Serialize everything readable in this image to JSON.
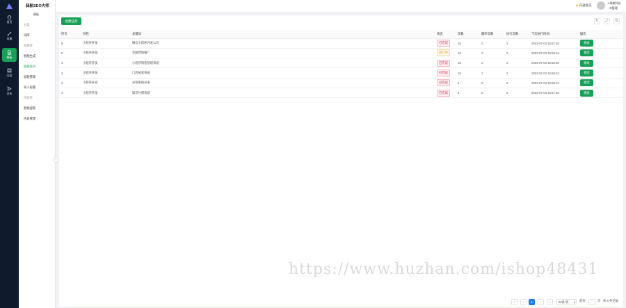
{
  "app": {
    "title": "驿航SEO大师"
  },
  "rail": {
    "items": [
      {
        "label": "首页",
        "icon": "home-icon"
      },
      {
        "label": "采集",
        "icon": "link-icon"
      },
      {
        "label": "模板",
        "icon": "document-icon",
        "active": true
      },
      {
        "label": "内容",
        "icon": "database-icon"
      },
      {
        "label": "发布",
        "icon": "send-icon"
      }
    ]
  },
  "sidebar": {
    "header": "模板",
    "items": [
      {
        "label": "分类",
        "type": "group"
      },
      {
        "label": "词库",
        "type": "item"
      },
      {
        "label": "标题库",
        "type": "group"
      },
      {
        "label": "智能生成",
        "type": "item"
      },
      {
        "label": "标题队列",
        "type": "item",
        "active": true
      },
      {
        "label": "标题管理",
        "type": "item"
      },
      {
        "label": "导入标题",
        "type": "item"
      },
      {
        "label": "内容库",
        "type": "group"
      },
      {
        "label": "智能提取",
        "type": "item"
      },
      {
        "label": "内容管理",
        "type": "item"
      }
    ]
  },
  "header": {
    "vip": "开通会员",
    "user": "驿航科技",
    "admin": "管理"
  },
  "toolbar": {
    "create_label": "创建任务"
  },
  "table": {
    "columns": [
      "序号",
      "归档",
      "关键词",
      "状态",
      "次数",
      "循环次数",
      "执行次数",
      "下次执行时间",
      "操作"
    ],
    "rows": [
      {
        "id": "6",
        "category": "小程序开发",
        "keyword": "微信小程序开发公司",
        "status": "已完成",
        "status_type": "done",
        "times": "10",
        "loops": "2",
        "runs": "2",
        "next": "2023-07-03 15:57:20",
        "action": "修改"
      },
      {
        "id": "5",
        "category": "小程序开发",
        "keyword": "金融营销推广",
        "status": "执行中",
        "status_type": "running",
        "times": "10",
        "loops": "2",
        "runs": "2",
        "next": "2023-07-03 15:56:10",
        "action": "修改"
      },
      {
        "id": "4",
        "category": "小程序开发",
        "keyword": "小程序销售管理系统",
        "status": "已完成",
        "status_type": "done",
        "times": "10",
        "loops": "2",
        "runs": "2",
        "next": "2023-07-03 15:56:30",
        "action": "修改"
      },
      {
        "id": "3",
        "category": "小程序开发",
        "keyword": "门店拓客系统",
        "status": "已完成",
        "status_type": "done",
        "times": "10",
        "loops": "2",
        "runs": "2",
        "next": "2023-07-03 15:56:10",
        "action": "修改"
      },
      {
        "id": "2",
        "category": "小程序开发",
        "keyword": "分销系统开发",
        "status": "已完成",
        "status_type": "done",
        "times": "5",
        "loops": "2",
        "runs": "2",
        "next": "2023-07-03 15:56:10",
        "action": "修改"
      },
      {
        "id": "1",
        "category": "小程序开发",
        "keyword": "知识付费系统",
        "status": "已完成",
        "status_type": "done",
        "times": "5",
        "loops": "2",
        "runs": "2",
        "next": "2023-07-03 15:57:20",
        "action": "修改"
      }
    ]
  },
  "pagination": {
    "current": "1",
    "page_size": "20条/页",
    "jump_label": "前往",
    "page_unit": "页",
    "total": "共 6 条记录"
  },
  "watermark": "https://www.huzhan.com/ishop48431",
  "colors": {
    "primary": "#18a058",
    "rail_bg": "#0f1b2d",
    "danger": "#d03050",
    "warning": "#f0a020",
    "page_active": "#2080f0"
  }
}
